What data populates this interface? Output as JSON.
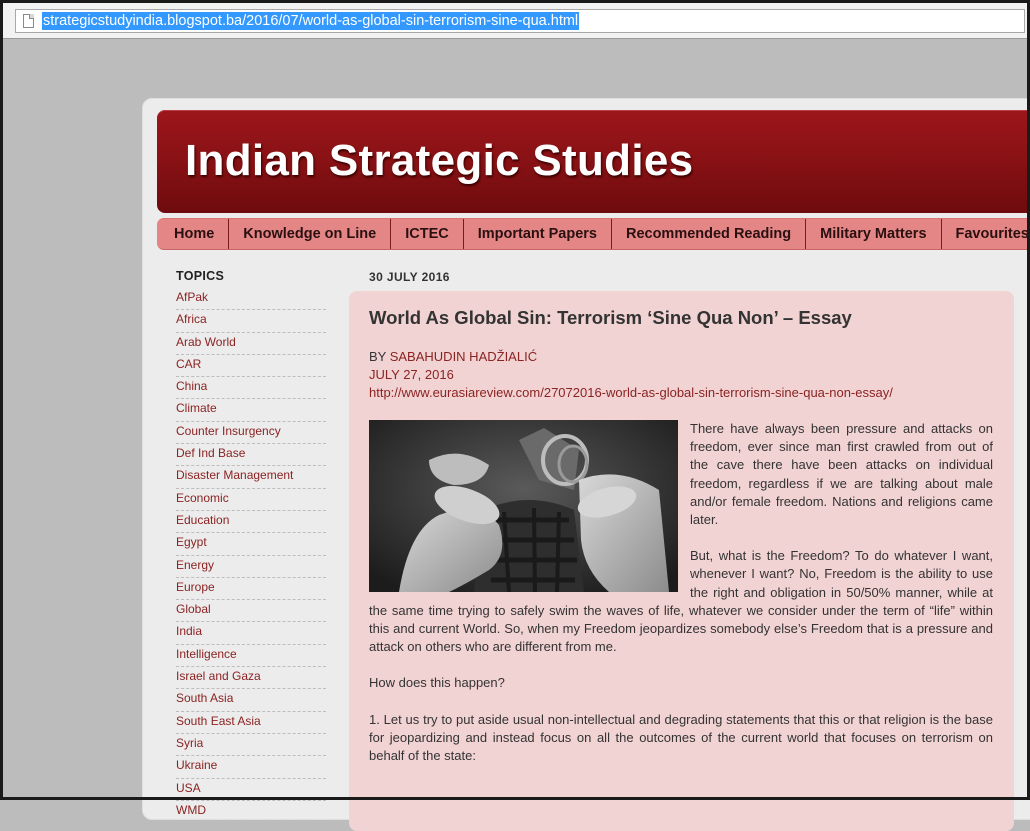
{
  "browser": {
    "url": "strategicstudyindia.blogspot.ba/2016/07/world-as-global-sin-terrorism-sine-qua.html",
    "icon": "page-icon"
  },
  "site": {
    "title": "Indian Strategic Studies",
    "accent": "#8a1215",
    "nav_bg": "#e58686",
    "post_bg": "#f2d3d3"
  },
  "nav": {
    "items": [
      "Home",
      "Knowledge on Line",
      "ICTEC",
      "Important Papers",
      "Recommended Reading",
      "Military Matters",
      "Favourites"
    ]
  },
  "sidebar": {
    "heading": "TOPICS",
    "items": [
      "AfPak",
      "Africa",
      "Arab World",
      "CAR",
      "China",
      "Climate",
      "Counter Insurgency",
      "Def Ind Base",
      "Disaster Management",
      "Economic",
      "Education",
      "Egypt",
      "Energy",
      "Europe",
      "Global",
      "India",
      "Intelligence",
      "Israel and Gaza",
      "South Asia",
      "South East Asia",
      "Syria",
      "Ukraine",
      "USA",
      "WMD"
    ]
  },
  "post": {
    "date_header": "30 JULY 2016",
    "title": "World As Global Sin: Terrorism ‘Sine Qua Non’ – Essay",
    "by_label": "BY ",
    "author": "SABAHUDIN HADŽIALIĆ",
    "date": "JULY 27, 2016",
    "link": "http://www.eurasiareview.com/27072016-world-as-global-sin-terrorism-sine-qua-non-essay/",
    "paragraphs": [
      "There have always been pressure and attacks on freedom, ever since man first crawled from out of the cave there have been attacks on individual freedom, regardless if we are talking about male and/or female freedom. Nations and religions came later.",
      "But, what is the Freedom? To do whatever I want, whenever I want? No, Freedom is the ability to use the right and obligation in 50/50% manner, while at the same time trying to safely swim the waves of life, whatever we consider under the term of “life” within this and current World. So, when my Freedom jeopardizes somebody else’s Freedom that is a pressure and attack on others who are different from me.",
      "How does this happen?",
      "1. Let us try to put aside usual non-intellectual and degrading statements that this or that religion is the base for jeopardizing and instead focus on all the outcomes of the current world that focuses on terrorism on behalf of the state:"
    ]
  }
}
